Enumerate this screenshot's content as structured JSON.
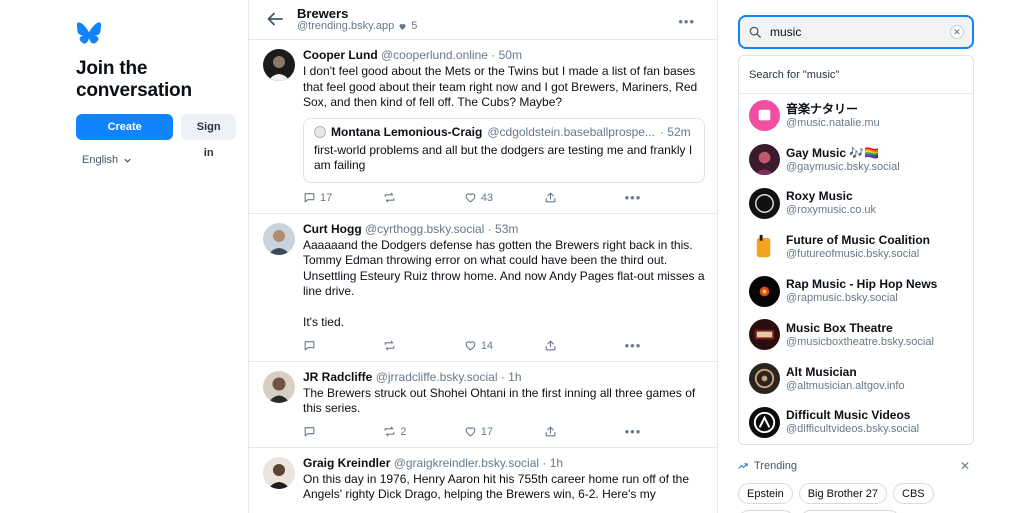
{
  "left": {
    "heading": "Join the conversation",
    "create_account": "Create account",
    "sign_in": "Sign in",
    "language": "English"
  },
  "feed": {
    "title": "Brewers",
    "handle": "@trending.bsky.app",
    "likes": "5",
    "posts": [
      {
        "name": "Cooper Lund",
        "handle": "@cooperlund.online",
        "time": "· 50m",
        "text": "I don't feel good about the Mets or the Twins but I made a list of fan bases that feel good about their team right now and I got Brewers, Mariners, Red Sox, and then kind of fell off. The Cubs? Maybe?",
        "quote": {
          "name": "Montana Lemonious-Craig",
          "handle": "@cdgoldstein.baseballprospe...",
          "time": "· 52m",
          "text": "first-world problems and all but the dodgers are testing me and frankly I am failing"
        },
        "replies": "17",
        "reposts": "",
        "likes": "43"
      },
      {
        "name": "Curt Hogg",
        "handle": "@cyrthogg.bsky.social",
        "time": "· 53m",
        "text": "Aaaaaand the Dodgers defense has gotten the Brewers right back in this. Tommy Edman throwing error on what could have been the third out. Unsettling Esteury Ruiz throw home. And now Andy Pages flat-out misses a line drive.\n\nIt's tied.",
        "replies": "",
        "reposts": "",
        "likes": "14"
      },
      {
        "name": "JR Radcliffe",
        "handle": "@jrradcliffe.bsky.social",
        "time": "· 1h",
        "text": "The Brewers struck out Shohei Ohtani in the first inning all three games of this series.",
        "replies": "",
        "reposts": "2",
        "likes": "17"
      },
      {
        "name": "Graig Kreindler",
        "handle": "@graigkreindler.bsky.social",
        "time": "· 1h",
        "text": "On this day in 1976, Henry Aaron hit his 755th career home run off of the Angels' righty Dick Drago, helping the Brewers win, 6-2. Here's my"
      }
    ]
  },
  "search": {
    "query": "music",
    "search_for": "Search for \"music\"",
    "results": [
      {
        "name": "音楽ナタリー",
        "handle": "@music.natalie.mu"
      },
      {
        "name": "Gay Music 🎶🏳️‍🌈",
        "handle": "@gaymusic.bsky.social"
      },
      {
        "name": "Roxy Music",
        "handle": "@roxymusic.co.uk"
      },
      {
        "name": "Future of Music Coalition",
        "handle": "@futureofmusic.bsky.social"
      },
      {
        "name": "Rap Music - Hip Hop News",
        "handle": "@rapmusic.bsky.social"
      },
      {
        "name": "Music Box Theatre",
        "handle": "@musicboxtheatre.bsky.social"
      },
      {
        "name": "Alt Musician",
        "handle": "@altmusician.altgov.info"
      },
      {
        "name": "Difficult Music Videos",
        "handle": "@difficultvideos.bsky.social"
      }
    ]
  },
  "trending": {
    "label": "Trending",
    "tags": [
      "Epstein",
      "Big Brother 27",
      "CBS"
    ]
  },
  "colors": {
    "accent": "#1083fe",
    "muted": "#68788a",
    "border": "#e4e8ec"
  }
}
